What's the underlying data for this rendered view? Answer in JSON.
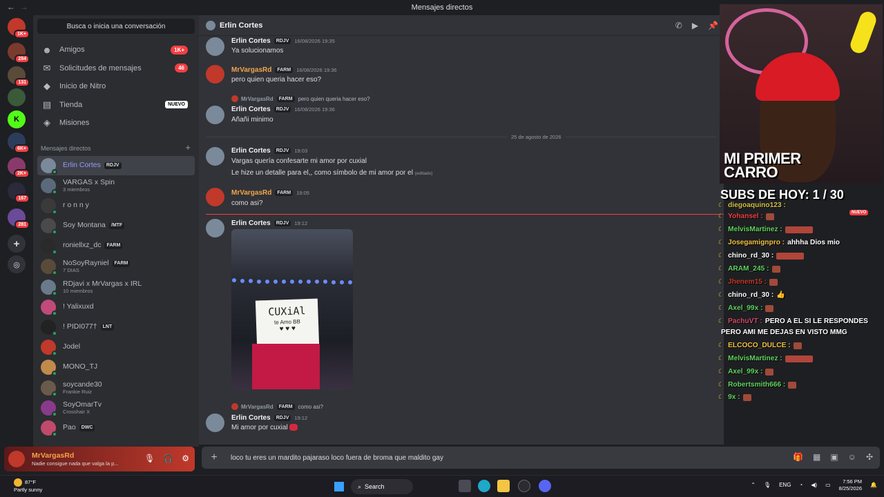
{
  "window": {
    "title": "Mensajes directos",
    "back": "←",
    "forward": "→"
  },
  "servers": [
    {
      "badge": "1K+",
      "color": "#c0392b"
    },
    {
      "badge": "284",
      "color": "#7a3b2e"
    },
    {
      "badge": "131",
      "color": "#5a4a3a"
    },
    {
      "badge": "",
      "color": "#3a5a3a"
    },
    {
      "badge": "",
      "color": "#53fc18",
      "letter": "K"
    },
    {
      "badge": "6K+",
      "color": "#2b3d5a"
    },
    {
      "badge": "2K+",
      "color": "#8a3a6a"
    },
    {
      "badge": "167",
      "color": "#2a2a3a"
    },
    {
      "badge": "281",
      "color": "#6a4a9a"
    }
  ],
  "sidebar": {
    "search": "Busca o inicia una conversación",
    "nav": [
      {
        "label": "Amigos",
        "count": "1K+",
        "icon": "friends-icon"
      },
      {
        "label": "Solicitudes de mensajes",
        "count": "46",
        "icon": "mail-icon"
      },
      {
        "label": "Inicio de Nitro",
        "count": "",
        "icon": "nitro-icon"
      },
      {
        "label": "Tienda",
        "count": "",
        "badge": "NUEVO",
        "icon": "shop-icon"
      },
      {
        "label": "Misiones",
        "count": "",
        "icon": "quests-icon"
      }
    ],
    "dm_header": "Mensajes directos",
    "dms": [
      {
        "name": "Erlin Cortes",
        "tag": "RDJV",
        "sub": "",
        "color": "#7a8a9a",
        "active": true
      },
      {
        "name": "VARGAS x Spin",
        "tag": "",
        "sub": "3 miembros",
        "color": "#5a6a7a"
      },
      {
        "name": "r o n n y",
        "tag": "",
        "sub": "",
        "color": "#3a3a3a"
      },
      {
        "name": "Soy Montana",
        "tag": "/MTF",
        "sub": "",
        "color": "#4a4a4a"
      },
      {
        "name": "roniellxz_dc",
        "tag": "FARM",
        "sub": "",
        "color": "#2a2a2a"
      },
      {
        "name": "NoSoyRayniel",
        "tag": "FARM",
        "sub": "7 DIAS",
        "color": "#5a4a3a"
      },
      {
        "name": "RDjavi x MrVargas x IRL",
        "tag": "",
        "sub": "10 miembros",
        "color": "#6a7a8a"
      },
      {
        "name": "! Yalixuxd",
        "tag": "",
        "sub": "",
        "color": "#c04a7a"
      },
      {
        "name": "! PIDI077†",
        "tag": "LNT",
        "sub": "",
        "color": "#222"
      },
      {
        "name": "Jodel",
        "tag": "",
        "sub": "",
        "color": "#c0392b"
      },
      {
        "name": "MONO_TJ",
        "tag": "",
        "sub": "",
        "color": "#c08a4a"
      },
      {
        "name": "soycande30",
        "tag": "",
        "sub": "Frankie Ruiz",
        "color": "#6a5a4a"
      },
      {
        "name": "SoyOmarTv",
        "tag": "",
        "sub": "Crosshair X",
        "color": "#8a3a8a"
      },
      {
        "name": "Pao",
        "tag": "DWC",
        "sub": "",
        "color": "#c04a6a"
      }
    ]
  },
  "user": {
    "name": "MrVargasRd",
    "status": "Nadie consigue nada que valga la p..."
  },
  "chat": {
    "header": "Erlin Cortes",
    "messages": [
      {
        "author": "Erlin Cortes",
        "tag": "RDJV",
        "time": "16/08/2026 19:35",
        "text": "Ya solucionamos"
      },
      {
        "author": "MrVargasRd",
        "tag": "FARM",
        "time": "16/08/2026 19:36",
        "text": "pero quien queria hacer eso?"
      },
      {
        "reply_author": "MrVargasRd",
        "reply_tag": "FARM",
        "reply_text": "pero quien queria hacer eso?",
        "author": "Erlin Cortes",
        "tag": "RDJV",
        "time": "16/08/2026 19:36",
        "text": "Añañi minimo"
      },
      {
        "author": "Erlin Cortes",
        "tag": "RDJV",
        "time": "19:03",
        "text": "Vargas quería confesarte mi amor por cuxial",
        "text2": "Le hize un detalle para el,, como símbolo de mi amor por el",
        "edited": "(editado)"
      },
      {
        "author": "MrVargasRd",
        "tag": "FARM",
        "time": "19:05",
        "text": "como asi?"
      },
      {
        "author": "Erlin Cortes",
        "tag": "RDJV",
        "time": "19:12",
        "card_text": "CUXiAl",
        "card_sub": "te Amo BB"
      },
      {
        "reply_author": "MrVargasRd",
        "reply_tag": "FARM",
        "reply_text": "como asi?",
        "author": "Erlin Cortes",
        "tag": "RDJV",
        "time": "19:12",
        "text": "Mi amor por cuxial"
      }
    ],
    "date_divider": "25 de agosto de 2026",
    "input_value": "loco tu eres un mardito pajaraso loco fuera de broma que maldito gay"
  },
  "stream": {
    "banner_line1": "MI PRIMER",
    "banner_line2": "CARRO",
    "subs": "SUBS DE HOY: 1 / 30",
    "nuevo": "NUEVO",
    "chat": [
      {
        "user": "diegoaquino123 :",
        "color": "#d4c04a"
      },
      {
        "user": "Yohansel :",
        "color": "#f23f43",
        "emote": "small"
      },
      {
        "user": "MelvisMartinez :",
        "color": "#5fd35f",
        "emote": "wide"
      },
      {
        "user": "Josegamignpro :",
        "color": "#f0c040",
        "text": "ahhha Dios mio"
      },
      {
        "user": "chino_rd_30 :",
        "color": "#ffffff",
        "emote": "wide"
      },
      {
        "user": "ARAM_245 :",
        "color": "#5fd35f",
        "emote": "small"
      },
      {
        "user": "Jhenem15 :",
        "color": "#c0392b",
        "emote": "small"
      },
      {
        "user": "chino_rd_30 :",
        "color": "#ffffff",
        "text": "👍"
      },
      {
        "user": "Axel_99x :",
        "color": "#5fd35f",
        "emote": "small"
      },
      {
        "user": "PachuVT :",
        "color": "#d04a6a",
        "text": "PERO A EL SI LE RESPONDES"
      },
      {
        "user": "",
        "color": "#ffffff",
        "text": "PERO AMI ME DEJAS EN VISTO MMG"
      },
      {
        "user": "ELCOCO_DULCE :",
        "color": "#f0c040",
        "emote": "small"
      },
      {
        "user": "MelvisMartinez :",
        "color": "#5fd35f",
        "emote": "wide"
      },
      {
        "user": "Axel_99x :",
        "color": "#5fd35f",
        "emote": "small"
      },
      {
        "user": "Robertsmith666 :",
        "color": "#5fd35f",
        "emote": "small"
      },
      {
        "user": "9x :",
        "color": "#5fd35f",
        "emote": "small"
      }
    ]
  },
  "taskbar": {
    "temp": "87°F",
    "weather": "Partly sunny",
    "search": "Search",
    "lang": "ENG",
    "time": "7:56 PM",
    "date": "8/25/2026"
  }
}
